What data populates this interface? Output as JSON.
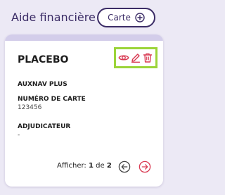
{
  "header": {
    "title": "Aide financière",
    "add_button_label": "Carte",
    "add_button_icon": "plus-circle-icon"
  },
  "card": {
    "title": "PLACEBO",
    "organization": "AUXNAV PLUS",
    "card_number_label": "NUMÉRO DE CARTE",
    "card_number_value": "123456",
    "adjudicator_label": "ADJUDICATEUR",
    "adjudicator_value": "-",
    "actions": [
      {
        "name": "view",
        "icon": "eye-icon"
      },
      {
        "name": "edit",
        "icon": "pencil-icon"
      },
      {
        "name": "delete",
        "icon": "trash-icon"
      }
    ]
  },
  "pagination": {
    "prefix": "Afficher:",
    "current": "1",
    "separator": "de",
    "total": "2",
    "prev_icon": "arrow-left-circle-icon",
    "next_icon": "arrow-right-circle-icon"
  },
  "colors": {
    "page_background": "#ece9f5",
    "primary_dark": "#3b2c66",
    "action_red": "#d93a52",
    "highlight_green": "#9cd43a",
    "card_accent": "#d3cdea"
  }
}
